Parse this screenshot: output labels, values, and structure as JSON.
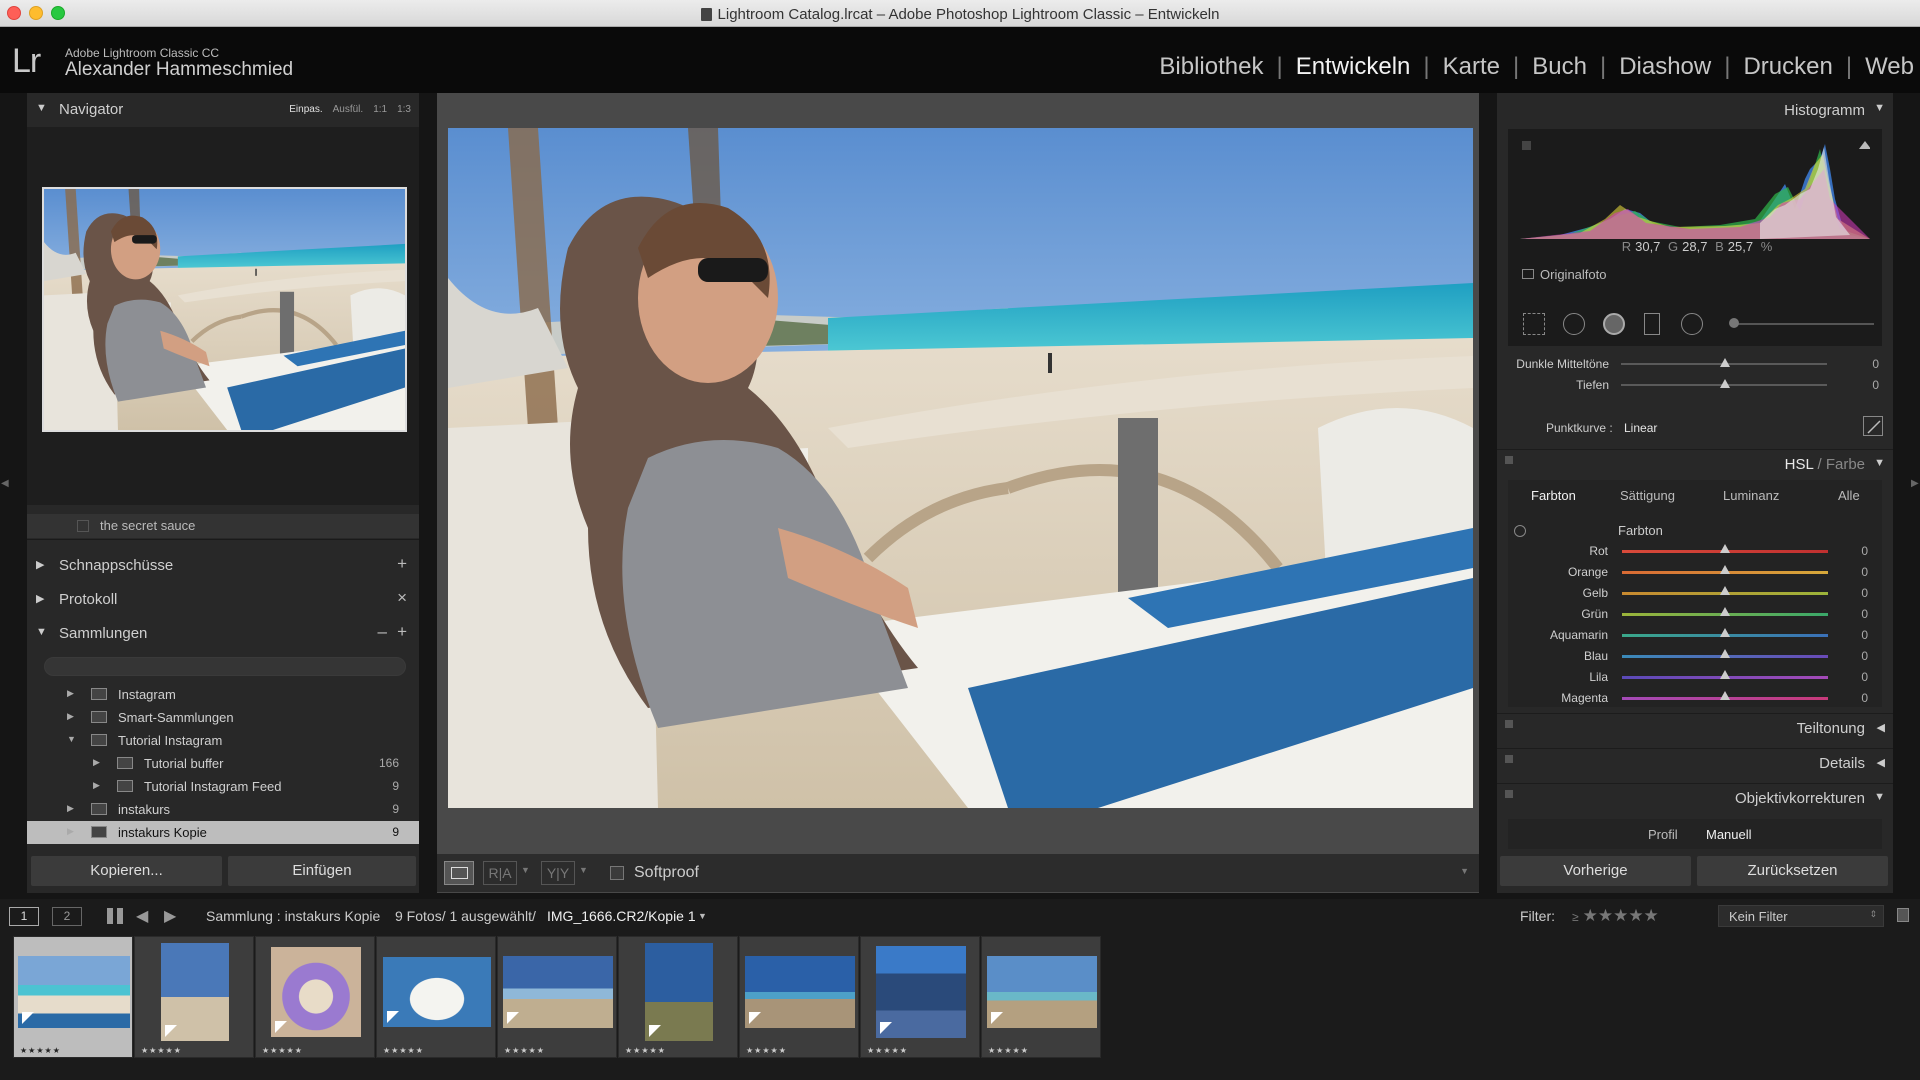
{
  "window": {
    "title": "Lightroom Catalog.lrcat – Adobe Photoshop Lightroom Classic – Entwickeln"
  },
  "identity": {
    "logo": "Lr",
    "product": "Adobe Lightroom Classic CC",
    "user": "Alexander Hammeschmied"
  },
  "modules": [
    "Bibliothek",
    "Entwickeln",
    "Karte",
    "Buch",
    "Diashow",
    "Drucken",
    "Web"
  ],
  "active_module": "Entwickeln",
  "left": {
    "navigator": {
      "title": "Navigator",
      "zoom": [
        "Einpas.",
        "Ausfül.",
        "1:1",
        "1:3"
      ],
      "zoom_selected": "Einpas."
    },
    "secret_row": "the secret sauce",
    "snapshots": {
      "title": "Schnappschüsse",
      "action": "+"
    },
    "history": {
      "title": "Protokoll",
      "action": "×"
    },
    "collections": {
      "title": "Sammlungen",
      "action_minus": "–",
      "action_plus": "+",
      "items": [
        {
          "label": "Instagram",
          "count": "",
          "level": 0,
          "expanded": false,
          "selected": false,
          "icon": "collection-set-icon"
        },
        {
          "label": "Smart-Sammlungen",
          "count": "",
          "level": 0,
          "expanded": false,
          "selected": false,
          "icon": "collection-set-icon"
        },
        {
          "label": "Tutorial Instagram",
          "count": "",
          "level": 0,
          "expanded": true,
          "selected": false,
          "icon": "collection-set-icon"
        },
        {
          "label": "Tutorial buffer",
          "count": "166",
          "level": 1,
          "expanded": false,
          "selected": false,
          "icon": "publish-collection-icon"
        },
        {
          "label": "Tutorial Instagram Feed",
          "count": "9",
          "level": 1,
          "expanded": false,
          "selected": false,
          "icon": "collection-icon"
        },
        {
          "label": "instakurs",
          "count": "9",
          "level": 0,
          "expanded": false,
          "selected": false,
          "icon": "collection-icon"
        },
        {
          "label": "instakurs Kopie",
          "count": "9",
          "level": 0,
          "expanded": false,
          "selected": true,
          "icon": "collection-icon"
        }
      ]
    },
    "buttons": {
      "copy": "Kopieren...",
      "paste": "Einfügen"
    }
  },
  "toolbar": {
    "softproof": "Softproof"
  },
  "right": {
    "histogram": {
      "title": "Histogramm",
      "r_label": "R",
      "r": "30,7",
      "g_label": "G",
      "g": "28,7",
      "b_label": "B",
      "b": "25,7",
      "unit": "%",
      "original": "Originalfoto"
    },
    "tone": {
      "rows": [
        {
          "label": "Dunkle Mitteltöne",
          "value": "0"
        },
        {
          "label": "Tiefen",
          "value": "0"
        }
      ],
      "point_curve_label": "Punktkurve :",
      "point_curve_value": "Linear"
    },
    "hsl": {
      "title_a": "HSL",
      "title_sep": " / ",
      "title_b": "Farbe",
      "tabs": [
        "Farbton",
        "Sättigung",
        "Luminanz",
        "Alle"
      ],
      "active_tab": "Farbton",
      "section_label": "Farbton",
      "rows": [
        {
          "label": "Rot",
          "value": "0",
          "from": "#d84a3a",
          "to": "#c03030"
        },
        {
          "label": "Orange",
          "value": "0",
          "from": "#d86a34",
          "to": "#d6a83a"
        },
        {
          "label": "Gelb",
          "value": "0",
          "from": "#c98a30",
          "to": "#9cb43a"
        },
        {
          "label": "Grün",
          "value": "0",
          "from": "#9cb43a",
          "to": "#3aa86a"
        },
        {
          "label": "Aquamarin",
          "value": "0",
          "from": "#3aa88a",
          "to": "#3a70b8"
        },
        {
          "label": "Blau",
          "value": "0",
          "from": "#3a8ab8",
          "to": "#6a4ab8"
        },
        {
          "label": "Lila",
          "value": "0",
          "from": "#5a4ab8",
          "to": "#a44ab8"
        },
        {
          "label": "Magenta",
          "value": "0",
          "from": "#a44ab8",
          "to": "#c83a7a"
        }
      ]
    },
    "split_toning": "Teiltonung",
    "details": "Details",
    "lens": {
      "title": "Objektivkorrekturen",
      "tab_profile": "Profil",
      "tab_manual": "Manuell"
    },
    "buttons": {
      "previous": "Vorherige",
      "reset": "Zurücksetzen"
    }
  },
  "filmstrip": {
    "view1": "1",
    "view2": "2",
    "source": "Sammlung : instakurs Kopie",
    "count": "9 Fotos/ 1 ausgewählt/",
    "filename": "IMG_1666.CR2/Kopie 1",
    "filter_label": "Filter:",
    "filter_value": "Kein Filter",
    "stars_glyph": "★★★★★",
    "thumbs": [
      {
        "name": "woman-beach-table",
        "selected": true
      },
      {
        "name": "man-walking-beach",
        "selected": false
      },
      {
        "name": "shells-hands",
        "selected": false
      },
      {
        "name": "dessert-plate",
        "selected": false
      },
      {
        "name": "couple-beach",
        "selected": false
      },
      {
        "name": "lighthouse",
        "selected": false
      },
      {
        "name": "beach-horizon",
        "selected": false
      },
      {
        "name": "signpost",
        "selected": false
      },
      {
        "name": "beach-people",
        "selected": false
      }
    ]
  },
  "colors": {
    "accent": "#f2f2f2",
    "panel": "#282828",
    "center": "#494949"
  }
}
